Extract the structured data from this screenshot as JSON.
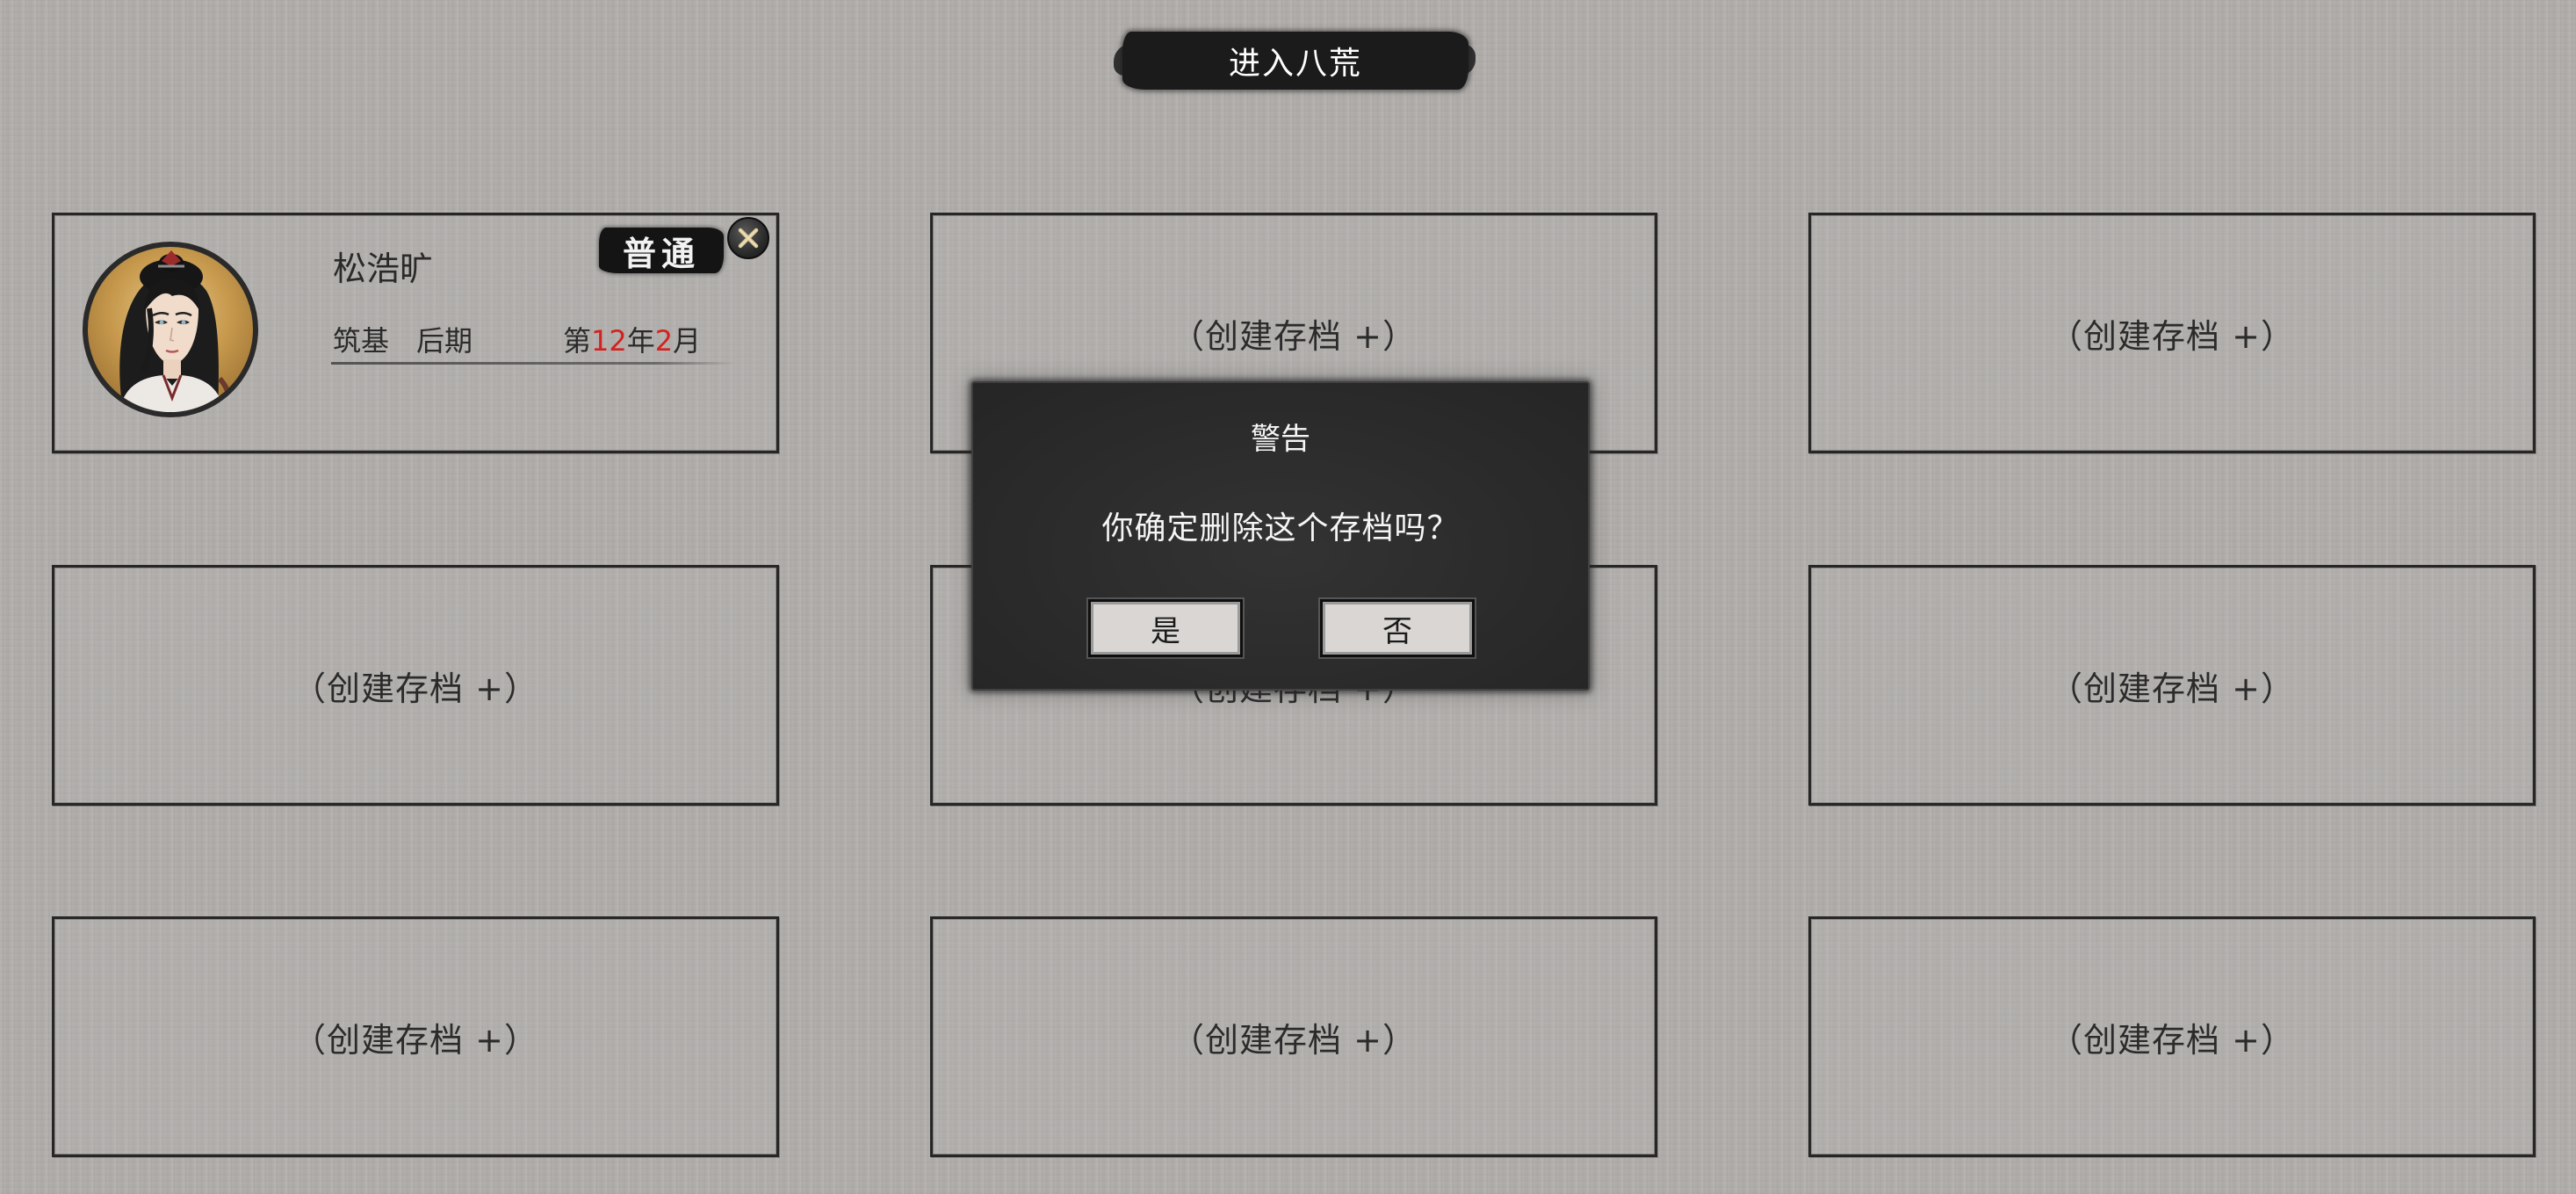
{
  "header": {
    "title": "进入八荒"
  },
  "filled_slot": {
    "character_name": "松浩旷",
    "realm": "筑基",
    "realm_stage": "后期",
    "date_prefix": "第",
    "year": "12",
    "year_unit": "年",
    "month": "2",
    "month_unit": "月",
    "difficulty": "普通",
    "delete_icon": "close-x-icon",
    "avatar_icon": "character-portrait"
  },
  "empty_slot_label": "（创建存档 +）",
  "empty_slots": [
    {
      "label": "（创建存档 +）"
    },
    {
      "label": "（创建存档 +）"
    },
    {
      "label": "（创建存档 +）"
    },
    {
      "label": "（创建存档 +）"
    },
    {
      "label": "（创建存档 +）"
    },
    {
      "label": "（创建存档 +）"
    },
    {
      "label": "（创建存档 +）"
    },
    {
      "label": "（创建存档 +）"
    }
  ],
  "dialog": {
    "title": "警告",
    "message": "你确定删除这个存档吗？",
    "confirm_label": "是",
    "cancel_label": "否"
  },
  "colors": {
    "background": "#b1aeab",
    "ink": "#1b1b1b",
    "date_highlight": "#d3221f",
    "dialog_bg": "#2a2a2a",
    "button_bg": "#d9d6d3"
  }
}
